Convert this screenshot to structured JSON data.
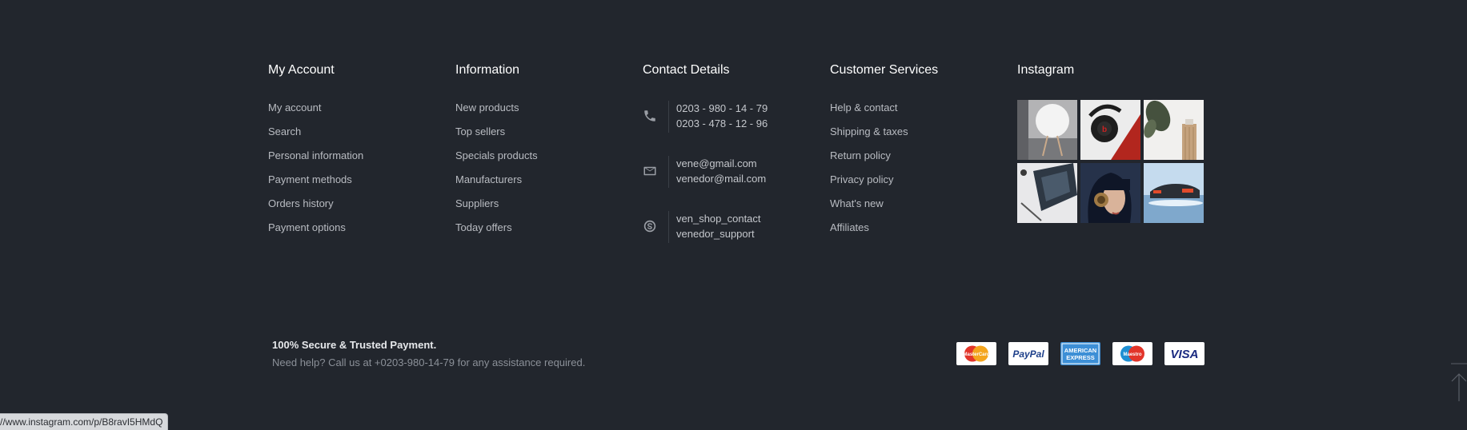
{
  "my_account": {
    "title": "My Account",
    "links": [
      "My account",
      "Search",
      "Personal information",
      "Payment methods",
      "Orders history",
      "Payment options"
    ]
  },
  "information": {
    "title": "Information",
    "links": [
      "New products",
      "Top sellers",
      "Specials products",
      "Manufacturers",
      "Suppliers",
      "Today offers"
    ]
  },
  "contact": {
    "title": "Contact Details",
    "phone": [
      "0203 - 980 - 14 - 79",
      "0203 - 478 - 12 - 96"
    ],
    "email": [
      "vene@gmail.com",
      "venedor@mail.com"
    ],
    "skype": [
      "ven_shop_contact",
      "venedor_support"
    ]
  },
  "customer_services": {
    "title": "Customer Services",
    "links": [
      "Help & contact",
      "Shipping & taxes",
      "Return policy",
      "Privacy policy",
      "What's new",
      "Affiliates"
    ]
  },
  "instagram": {
    "title": "Instagram"
  },
  "secure": {
    "title": "100% Secure & Trusted Payment.",
    "help": "Need help? Call us at +0203-980-14-79 for any assistance required."
  },
  "payments": {
    "mastercard": "MasterCard",
    "paypal": "PayPal",
    "amex_line1": "AMERICAN",
    "amex_line2": "EXPRESS",
    "maestro": "Maestro",
    "visa": "VISA"
  },
  "status_bar": {
    "url": "//www.instagram.com/p/B8ravI5HMdQ"
  },
  "colors": {
    "background": "#22262d",
    "heading": "#ffffff",
    "link": "#b9bcc2"
  }
}
